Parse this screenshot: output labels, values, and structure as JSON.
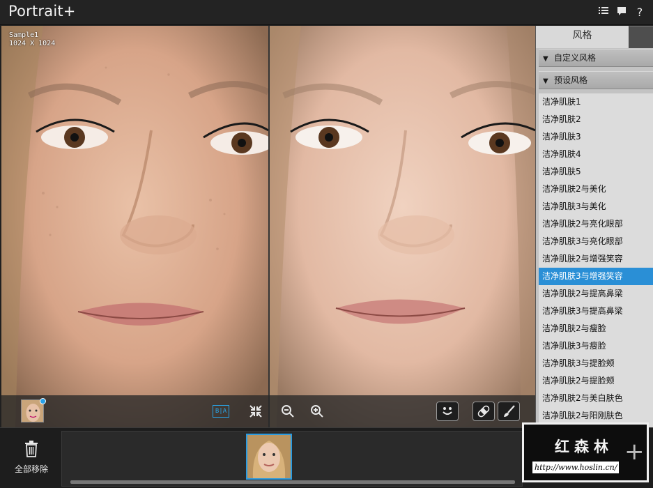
{
  "app": {
    "title": "Portrait+",
    "icons": [
      "list-icon",
      "chat-icon",
      "help-icon"
    ],
    "help_glyph": "?"
  },
  "viewer": {
    "sample_name": "Sample1",
    "sample_size": "1024 X 1024",
    "ba_label": "B|A"
  },
  "right_panel": {
    "tab_label": "风格",
    "custom_section": "自定义风格",
    "preset_section": "预设风格",
    "presets": [
      "洁净肌肤1",
      "洁净肌肤2",
      "洁净肌肤3",
      "洁净肌肤4",
      "洁净肌肤5",
      "洁净肌肤2与美化",
      "洁净肌肤3与美化",
      "洁净肌肤2与亮化眼部",
      "洁净肌肤3与亮化眼部",
      "洁净肌肤2与增强笑容",
      "洁净肌肤3与增强笑容",
      "洁净肌肤2与提高鼻梁",
      "洁净肌肤3与提高鼻梁",
      "洁净肌肤2与瘦脸",
      "洁净肌肤3与瘦脸",
      "洁净肌肤3与提脸颊",
      "洁净肌肤2与提脸颊",
      "洁净肌肤2与美白肤色",
      "洁净肌肤2与阳刚肤色"
    ],
    "selected_index": 10
  },
  "bottom": {
    "remove_all_label": "全部移除"
  },
  "watermark": {
    "cn": "红森林",
    "url": "http://www.hoslin.cn/"
  },
  "colors": {
    "accent": "#2a8fd6",
    "panel_bg": "#dcdcdc"
  }
}
